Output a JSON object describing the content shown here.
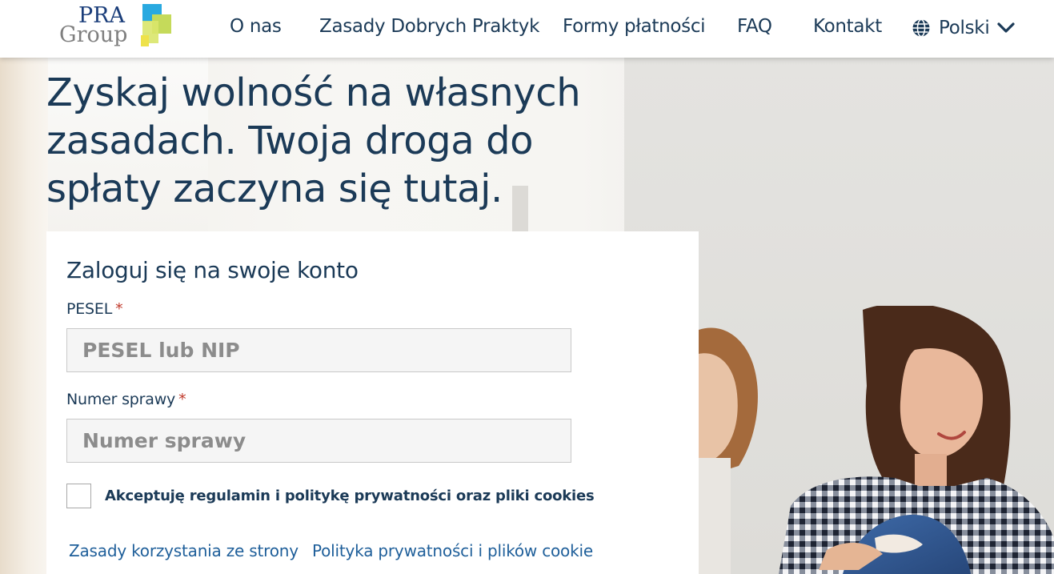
{
  "header": {
    "logo": {
      "line1": "PRA",
      "line2": "Group"
    },
    "nav": [
      {
        "label": "O nas"
      },
      {
        "label": "Zasady Dobrych Praktyk"
      },
      {
        "label": "Formy płatności"
      },
      {
        "label": "FAQ"
      },
      {
        "label": "Kontakt"
      }
    ],
    "language": {
      "label": "Polski",
      "icon": "globe-icon",
      "chevron": "chevron-down-icon"
    }
  },
  "hero": {
    "headline_lines": [
      "Zyskaj wolność na własnych",
      "zasadach. Twoja droga do",
      "spłaty zaczyna się tutaj."
    ]
  },
  "login": {
    "title": "Zaloguj się na swoje konto",
    "pesel": {
      "label": "PESEL",
      "required": "*",
      "placeholder": "PESEL lub NIP",
      "value": ""
    },
    "case_number": {
      "label": "Numer sprawy",
      "required": "*",
      "placeholder": "Numer sprawy",
      "value": ""
    },
    "consent": {
      "label": "Akceptuję regulamin i politykę prywatności oraz pliki cookies",
      "checked": false
    },
    "links": [
      {
        "label": "Zasady korzystania ze strony"
      },
      {
        "label": "Polityka prywatności i plików cookie"
      }
    ]
  },
  "colors": {
    "primary_text": "#1b3a57",
    "link": "#1f5f9a",
    "required": "#c0392b",
    "logo_blue": "#1a3d7a",
    "logo_green": "#8dc63f",
    "logo_cyan": "#29a9e0"
  }
}
